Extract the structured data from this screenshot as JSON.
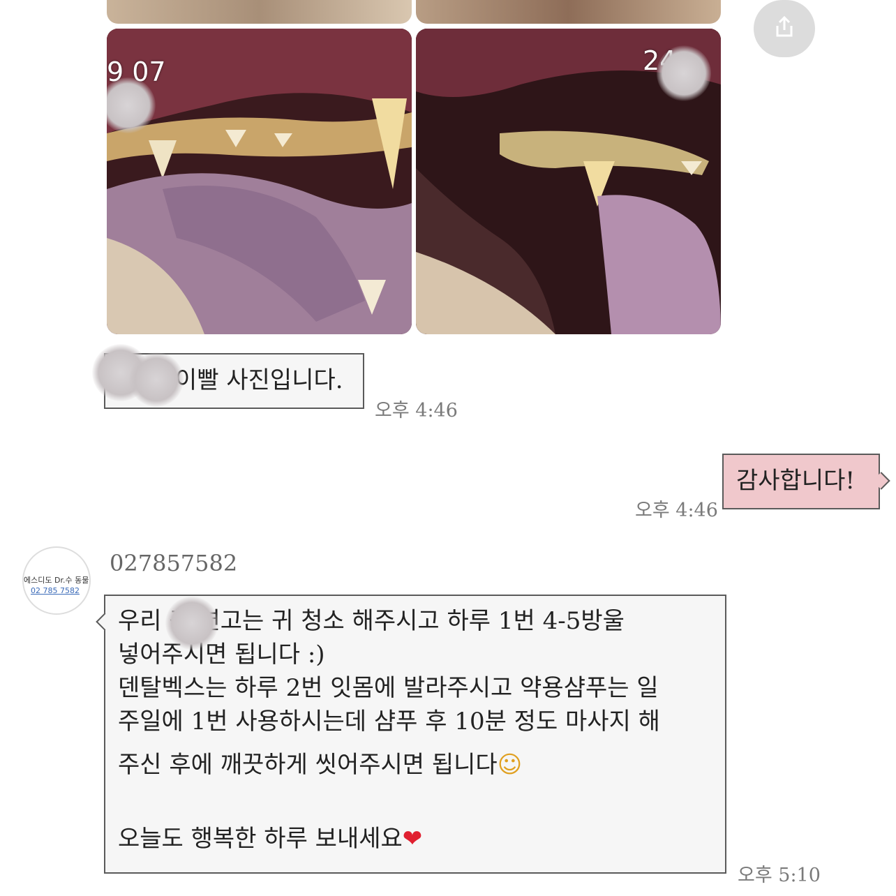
{
  "photos": {
    "left_stamp": "9 07",
    "right_stamp": "24"
  },
  "messages": {
    "m1": {
      "text": "이빨 사진입니다.",
      "time": "오후 4:46"
    },
    "m2": {
      "text": "감사합니다!",
      "time": "오후 4:46"
    },
    "m3": {
      "sender": "027857582",
      "avatar_line1": "에스디도 Dr.수 동물병원",
      "avatar_line2": "02 785 7582",
      "lines": [
        "우리     귀 연고는 귀 청소 해주시고 하루 1번 4-5방울",
        "넣어주시면 됩니다 :)",
        "덴탈벡스는 하루 2번 잇몸에 발라주시고 약용샴푸는 일",
        "주일에 1번 사용하시는데 샴푸 후 10분 정도 마사지 해",
        "주신 후에 깨끗하게 씻어주시면 됩니다",
        "",
        "오늘도 행복한 하루 보내세요"
      ],
      "emoji_smile": "☺",
      "emoji_heart": "❤",
      "time": "오후 5:10"
    }
  },
  "icons": {
    "share": "share-icon"
  }
}
